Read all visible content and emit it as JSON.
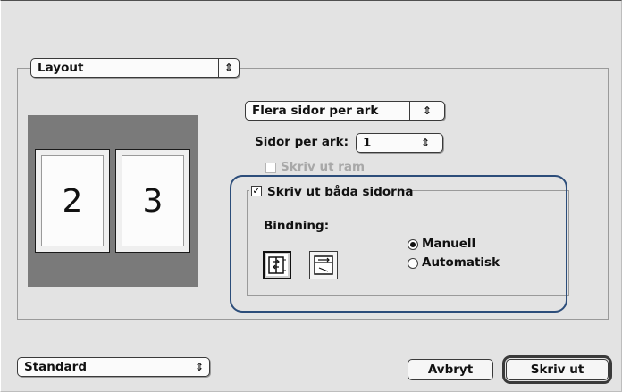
{
  "panel_select": {
    "value": "Layout"
  },
  "pages_layout_select": {
    "value": "Flera sidor per ark"
  },
  "pages_per_sheet": {
    "label": "Sidor per ark:",
    "value": "1"
  },
  "print_border": {
    "label": "Skriv ut ram",
    "checked": false,
    "enabled": false
  },
  "preview": {
    "pages": [
      "2",
      "3"
    ]
  },
  "duplex": {
    "label": "Skriv ut båda sidorna",
    "checked": true,
    "binding_label": "Bindning:",
    "binding_icons": [
      "book-binding-icon",
      "tablet-binding-icon"
    ],
    "mode": {
      "options": [
        "Manuell",
        "Automatisk"
      ],
      "selected": "Manuell"
    }
  },
  "presets_select": {
    "value": "Standard"
  },
  "buttons": {
    "cancel": "Avbryt",
    "print": "Skriv ut"
  },
  "colors": {
    "highlight": "#2c4d7a",
    "preview_bg": "#7a7a7a"
  }
}
